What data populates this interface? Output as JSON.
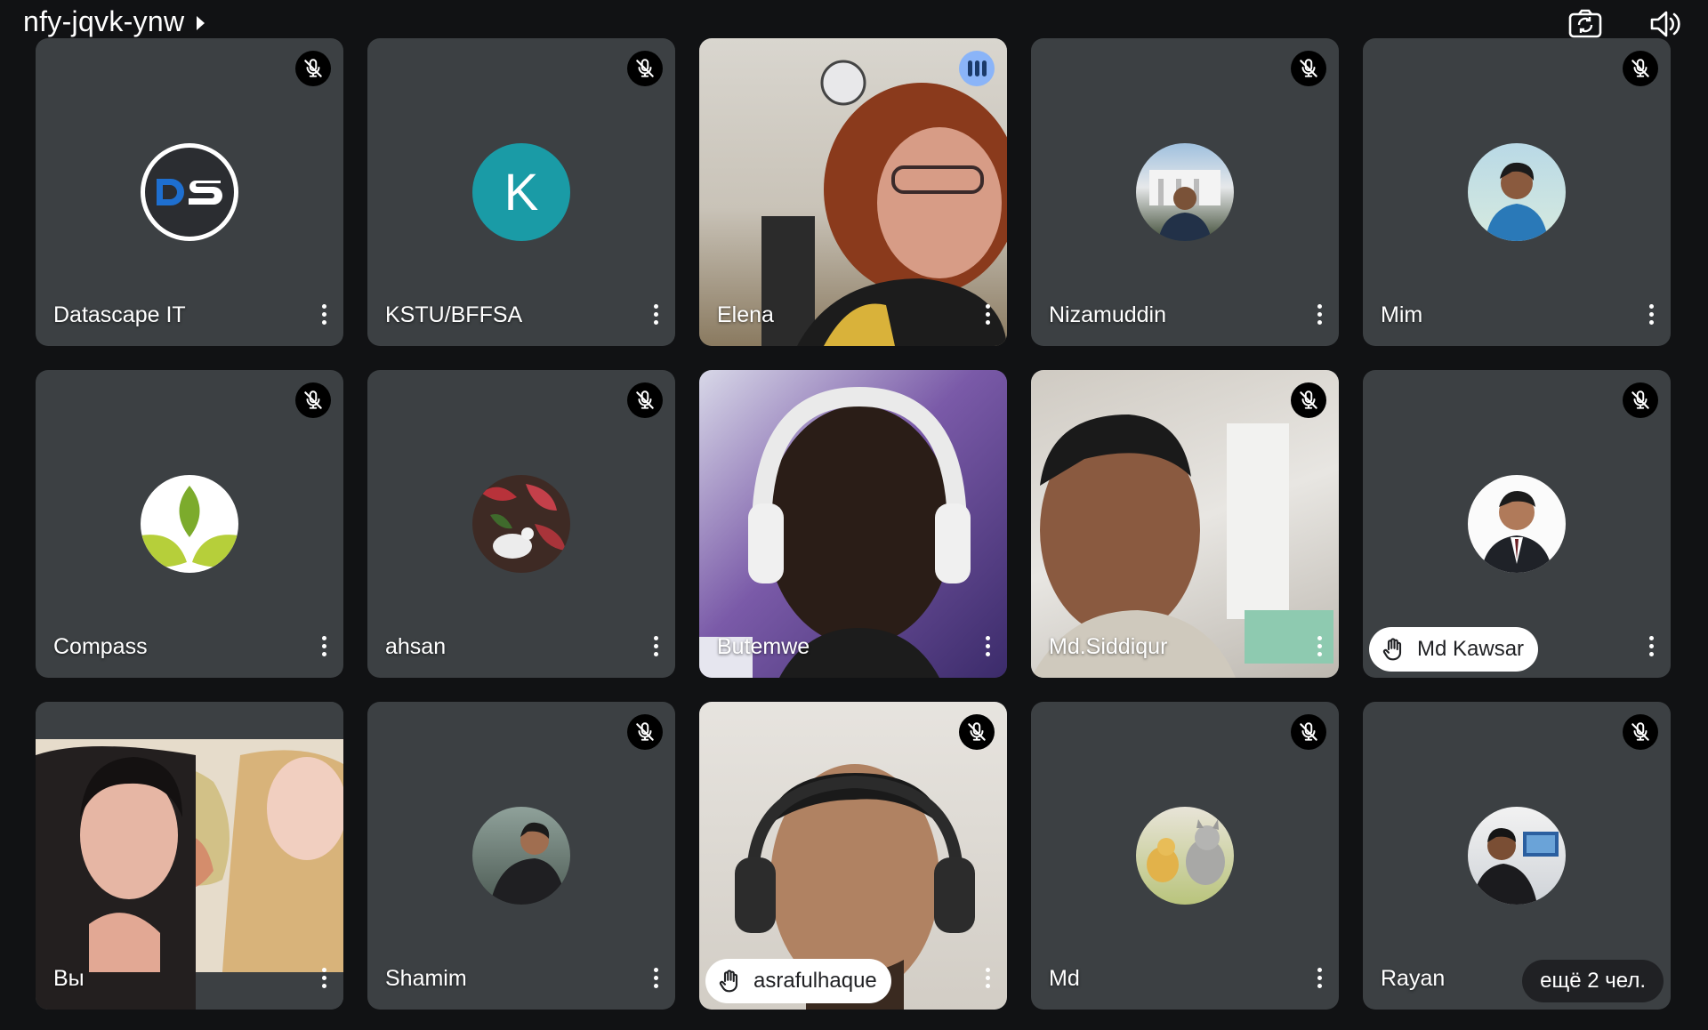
{
  "meeting": {
    "code": "nfy-jqvk-ynw"
  },
  "toolbar": {
    "icons": [
      "switch-camera-icon",
      "speaker-icon"
    ]
  },
  "participants": [
    {
      "name": "Datascape IT",
      "avatar": "DS logo",
      "muted": true
    },
    {
      "name": "KSTU/BFFSA",
      "avatar_initial": "K",
      "avatar_color": "#1a9ba6",
      "muted": true
    },
    {
      "name": "Elena",
      "video": true,
      "speaking": true
    },
    {
      "name": "Nizamuddin",
      "avatar": "photo",
      "muted": true
    },
    {
      "name": "Mim",
      "avatar": "photo",
      "muted": true
    },
    {
      "name": "Compass",
      "avatar": "leaf logo",
      "muted": true
    },
    {
      "name": "ahsan",
      "avatar": "photo",
      "muted": true
    },
    {
      "name": "Butemwe",
      "video": true
    },
    {
      "name": "Md.Siddiqur",
      "video": true,
      "muted": true
    },
    {
      "name": "Md Kawsar",
      "avatar": "photo",
      "muted": true,
      "hand_raised": true
    },
    {
      "name": "Вы",
      "video": true
    },
    {
      "name": "Shamim",
      "avatar": "photo",
      "muted": true
    },
    {
      "name": "asrafulhaque",
      "video": true,
      "muted": true,
      "hand_raised": true
    },
    {
      "name": "Md",
      "avatar": "photo",
      "muted": true
    },
    {
      "name": "Rayan",
      "avatar": "photo",
      "muted": true
    }
  ],
  "overflow": {
    "label": "ещё 2 чел."
  },
  "colors": {
    "tile_bg": "#3c4043",
    "page_bg": "#111214",
    "speaking_accent": "#8ab4f8"
  }
}
